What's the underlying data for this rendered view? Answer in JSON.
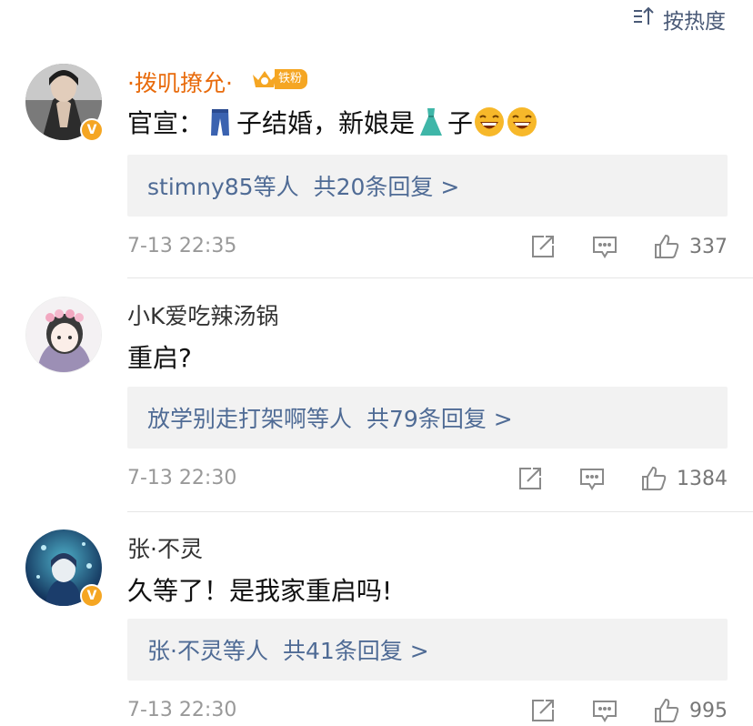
{
  "sort": {
    "label": "按热度",
    "icon": "sort-icon"
  },
  "comments": [
    {
      "username": "·拨叽撩允·",
      "fan_badge": "铁粉",
      "text_parts": [
        "官宣：",
        "子结婚，新娘是",
        "子"
      ],
      "reply": {
        "who": "stimny85等人",
        "count": "共20条回复 >"
      },
      "time": "7-13 22:35",
      "likes": "337"
    },
    {
      "username": "小K爱吃辣汤锅",
      "text": "重启?",
      "reply": {
        "who": "放学别走打架啊等人",
        "count": "共79条回复 >"
      },
      "time": "7-13 22:30",
      "likes": "1384"
    },
    {
      "username": "张·不灵",
      "text": "久等了！是我家重启吗!",
      "reply": {
        "who": "张·不灵等人",
        "count": "共41条回复 >"
      },
      "time": "7-13 22:30",
      "likes": "995"
    }
  ],
  "colors": {
    "accent_link": "#4f6b95",
    "vip_name": "#e86b0c",
    "badge": "#f5a623"
  },
  "icons": [
    "jeans-emoji",
    "dress-emoji",
    "laughing-emoji",
    "share-icon",
    "comment-icon",
    "like-icon",
    "verified-icon",
    "crown-icon"
  ]
}
